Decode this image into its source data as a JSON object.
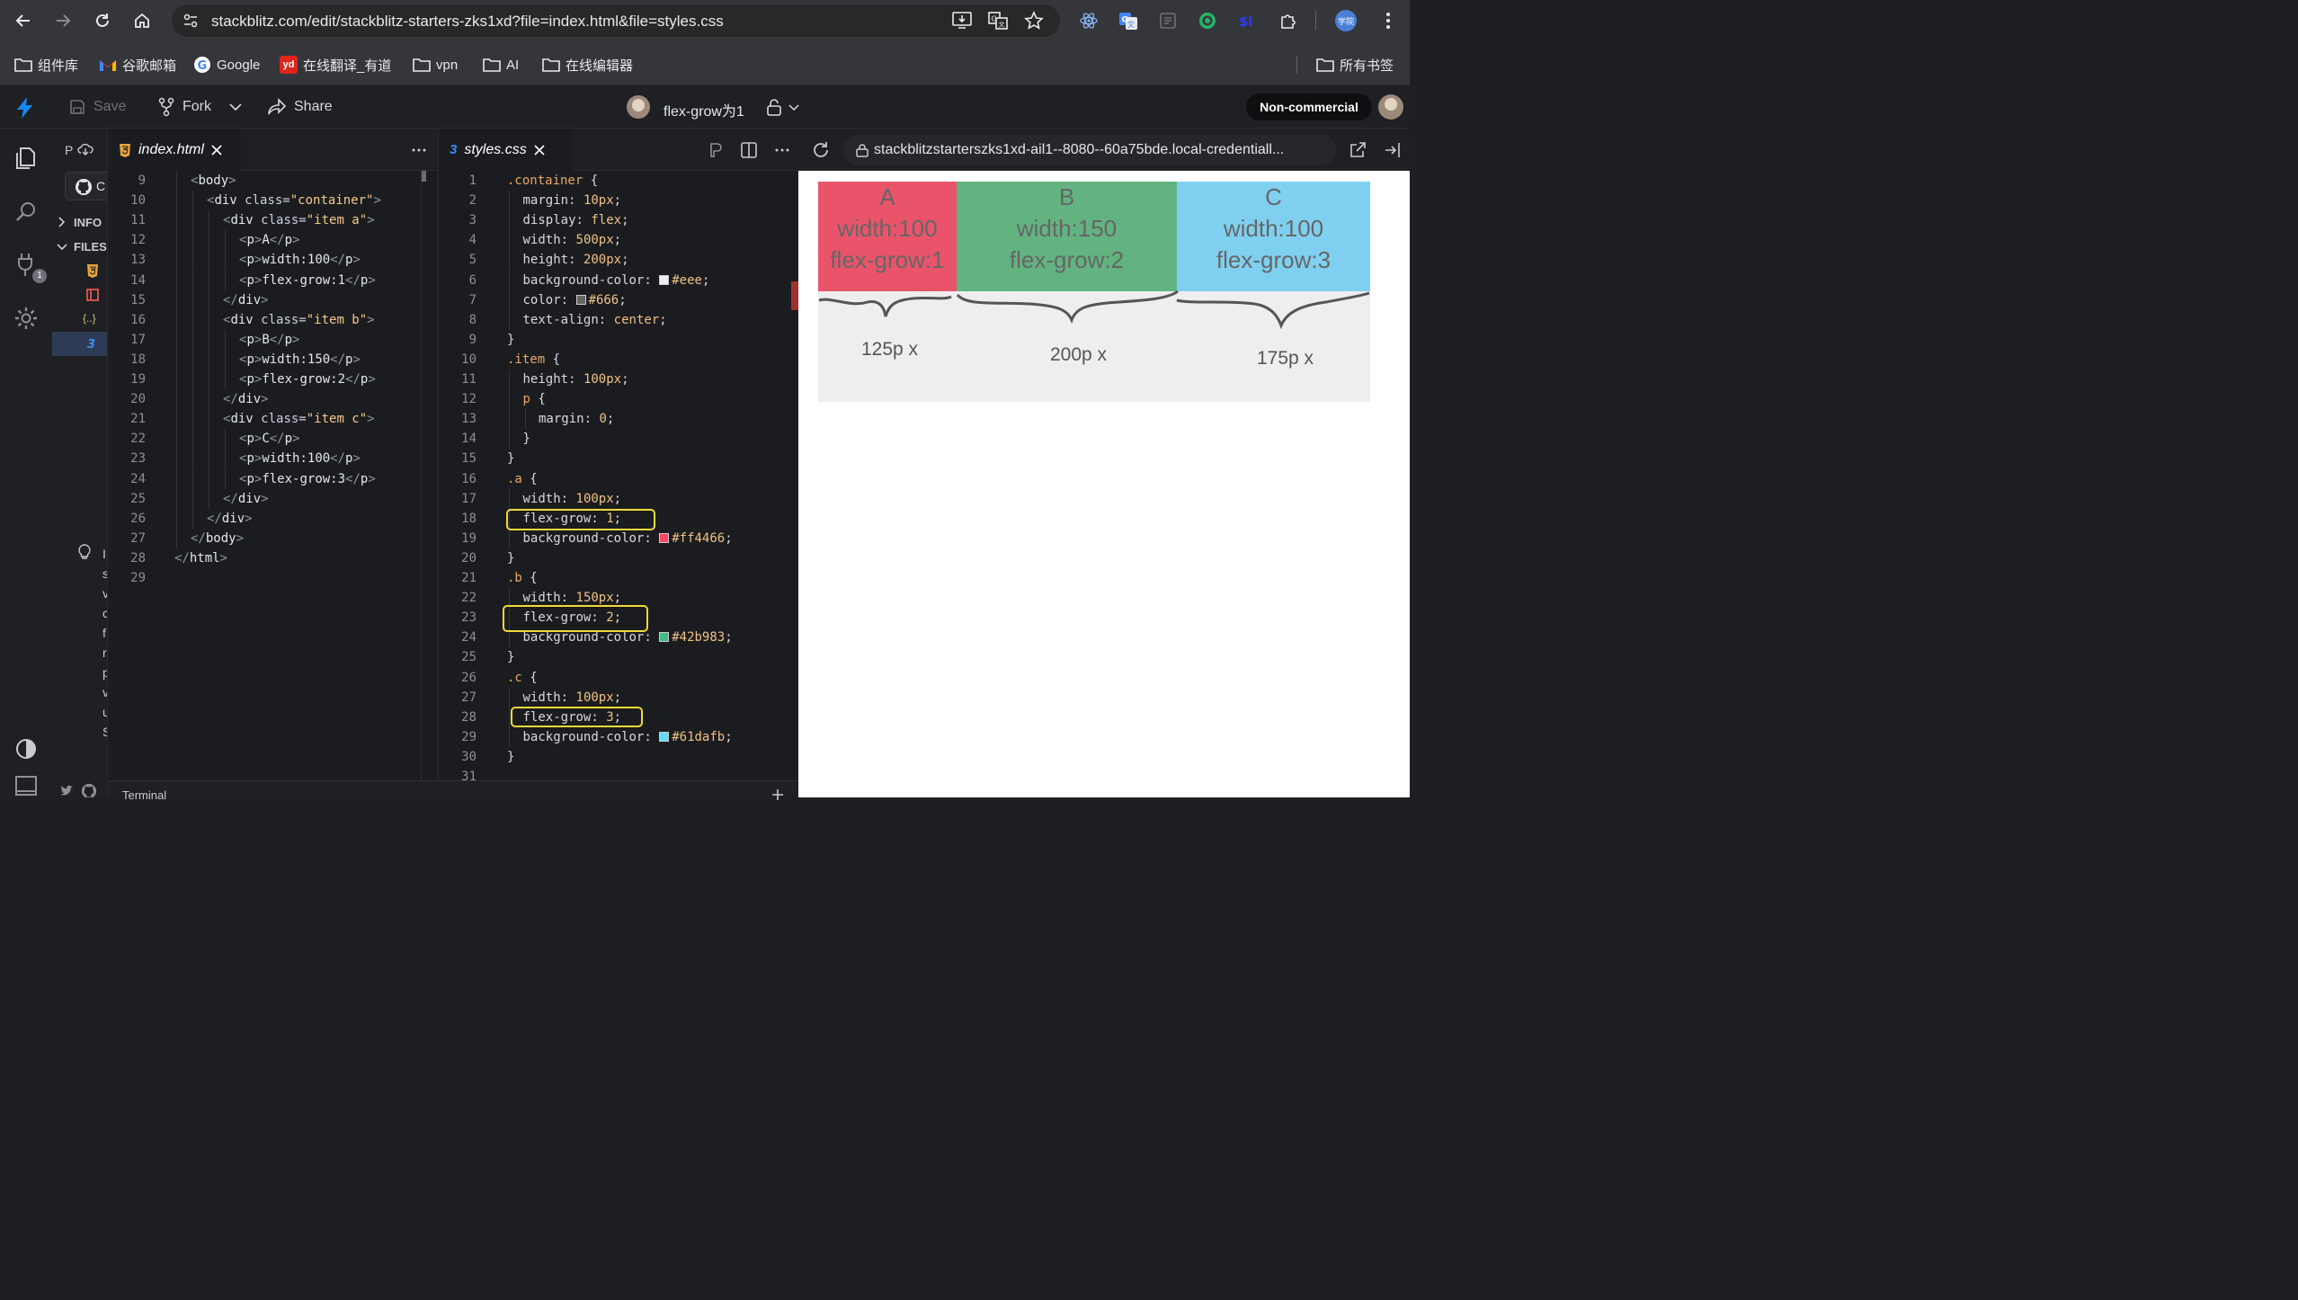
{
  "browser": {
    "url": "stackblitz.com/edit/stackblitz-starters-zks1xd?file=index.html&file=styles.css",
    "profile_label": "学院"
  },
  "bookmarks": [
    {
      "label": "组件库",
      "icon": "folder-icon"
    },
    {
      "label": "谷歌邮箱",
      "icon": "gmail-icon"
    },
    {
      "label": "Google",
      "icon": "google-icon"
    },
    {
      "label": "在线翻译_有道",
      "icon": "youdao-icon",
      "badge": "yd"
    },
    {
      "label": "vpn",
      "icon": "folder-icon"
    },
    {
      "label": "AI",
      "icon": "folder-icon"
    },
    {
      "label": "在线编辑器",
      "icon": "folder-icon"
    },
    {
      "label": "所有书签",
      "icon": "folder-icon"
    }
  ],
  "header": {
    "save": "Save",
    "fork": "Fork",
    "share": "Share",
    "project": "flex-grow为1",
    "license": "Non-commercial"
  },
  "activity": {
    "badge": "1"
  },
  "tree": {
    "project_initial": "P",
    "sections": [
      "INFO",
      "FILES"
    ],
    "github_initial": "C",
    "tip_letters": [
      "I",
      "s",
      "v",
      "c",
      "f",
      "r",
      "p",
      "v",
      "u",
      "S"
    ]
  },
  "tabs": {
    "left": "index.html",
    "right": "styles.css"
  },
  "html_lines": [
    {
      "n": "9",
      "indent": 1,
      "parts": [
        [
          "tag",
          "<"
        ],
        [
          "tn",
          "body"
        ],
        [
          "tag",
          ">"
        ]
      ]
    },
    {
      "n": "10",
      "indent": 2,
      "parts": [
        [
          "tag",
          "<"
        ],
        [
          "tn",
          "div "
        ],
        [
          "an",
          "class="
        ],
        [
          "av",
          "\"container\""
        ],
        [
          "tag",
          ">"
        ]
      ]
    },
    {
      "n": "11",
      "indent": 3,
      "parts": [
        [
          "tag",
          "<"
        ],
        [
          "tn",
          "div "
        ],
        [
          "an",
          "class="
        ],
        [
          "av",
          "\"item a\""
        ],
        [
          "tag",
          ">"
        ]
      ]
    },
    {
      "n": "12",
      "indent": 4,
      "parts": [
        [
          "tag",
          "<"
        ],
        [
          "tn",
          "p"
        ],
        [
          "tag",
          ">"
        ],
        [
          "tn",
          "A"
        ],
        [
          "tag",
          "</"
        ],
        [
          "tn",
          "p"
        ],
        [
          "tag",
          ">"
        ]
      ]
    },
    {
      "n": "13",
      "indent": 4,
      "parts": [
        [
          "tag",
          "<"
        ],
        [
          "tn",
          "p"
        ],
        [
          "tag",
          ">"
        ],
        [
          "tn",
          "width:100"
        ],
        [
          "tag",
          "</"
        ],
        [
          "tn",
          "p"
        ],
        [
          "tag",
          ">"
        ]
      ]
    },
    {
      "n": "14",
      "indent": 4,
      "parts": [
        [
          "tag",
          "<"
        ],
        [
          "tn",
          "p"
        ],
        [
          "tag",
          ">"
        ],
        [
          "tn",
          "flex-grow:1"
        ],
        [
          "tag",
          "</"
        ],
        [
          "tn",
          "p"
        ],
        [
          "tag",
          ">"
        ]
      ]
    },
    {
      "n": "15",
      "indent": 3,
      "parts": [
        [
          "tag",
          "</"
        ],
        [
          "tn",
          "div"
        ],
        [
          "tag",
          ">"
        ]
      ]
    },
    {
      "n": "16",
      "indent": 3,
      "parts": [
        [
          "tag",
          "<"
        ],
        [
          "tn",
          "div "
        ],
        [
          "an",
          "class="
        ],
        [
          "av",
          "\"item b\""
        ],
        [
          "tag",
          ">"
        ]
      ]
    },
    {
      "n": "17",
      "indent": 4,
      "parts": [
        [
          "tag",
          "<"
        ],
        [
          "tn",
          "p"
        ],
        [
          "tag",
          ">"
        ],
        [
          "tn",
          "B"
        ],
        [
          "tag",
          "</"
        ],
        [
          "tn",
          "p"
        ],
        [
          "tag",
          ">"
        ]
      ]
    },
    {
      "n": "18",
      "indent": 4,
      "parts": [
        [
          "tag",
          "<"
        ],
        [
          "tn",
          "p"
        ],
        [
          "tag",
          ">"
        ],
        [
          "tn",
          "width:150"
        ],
        [
          "tag",
          "</"
        ],
        [
          "tn",
          "p"
        ],
        [
          "tag",
          ">"
        ]
      ]
    },
    {
      "n": "19",
      "indent": 4,
      "parts": [
        [
          "tag",
          "<"
        ],
        [
          "tn",
          "p"
        ],
        [
          "tag",
          ">"
        ],
        [
          "tn",
          "flex-grow:2"
        ],
        [
          "tag",
          "</"
        ],
        [
          "tn",
          "p"
        ],
        [
          "tag",
          ">"
        ]
      ]
    },
    {
      "n": "20",
      "indent": 3,
      "parts": [
        [
          "tag",
          "</"
        ],
        [
          "tn",
          "div"
        ],
        [
          "tag",
          ">"
        ]
      ]
    },
    {
      "n": "21",
      "indent": 3,
      "parts": [
        [
          "tag",
          "<"
        ],
        [
          "tn",
          "div "
        ],
        [
          "an",
          "class="
        ],
        [
          "av",
          "\"item c\""
        ],
        [
          "tag",
          ">"
        ]
      ]
    },
    {
      "n": "22",
      "indent": 4,
      "parts": [
        [
          "tag",
          "<"
        ],
        [
          "tn",
          "p"
        ],
        [
          "tag",
          ">"
        ],
        [
          "tn",
          "C"
        ],
        [
          "tag",
          "</"
        ],
        [
          "tn",
          "p"
        ],
        [
          "tag",
          ">"
        ]
      ]
    },
    {
      "n": "23",
      "indent": 4,
      "parts": [
        [
          "tag",
          "<"
        ],
        [
          "tn",
          "p"
        ],
        [
          "tag",
          ">"
        ],
        [
          "tn",
          "width:100"
        ],
        [
          "tag",
          "</"
        ],
        [
          "tn",
          "p"
        ],
        [
          "tag",
          ">"
        ]
      ]
    },
    {
      "n": "24",
      "indent": 4,
      "parts": [
        [
          "tag",
          "<"
        ],
        [
          "tn",
          "p"
        ],
        [
          "tag",
          ">"
        ],
        [
          "tn",
          "flex-grow:3"
        ],
        [
          "tag",
          "</"
        ],
        [
          "tn",
          "p"
        ],
        [
          "tag",
          ">"
        ]
      ]
    },
    {
      "n": "25",
      "indent": 3,
      "parts": [
        [
          "tag",
          "</"
        ],
        [
          "tn",
          "div"
        ],
        [
          "tag",
          ">"
        ]
      ]
    },
    {
      "n": "26",
      "indent": 2,
      "parts": [
        [
          "tag",
          "</"
        ],
        [
          "tn",
          "div"
        ],
        [
          "tag",
          ">"
        ]
      ]
    },
    {
      "n": "27",
      "indent": 1,
      "parts": [
        [
          "tag",
          "</"
        ],
        [
          "tn",
          "body"
        ],
        [
          "tag",
          ">"
        ]
      ]
    },
    {
      "n": "28",
      "indent": 0,
      "parts": [
        [
          "tag",
          "</"
        ],
        [
          "tn",
          "html"
        ],
        [
          "tag",
          ">"
        ]
      ]
    },
    {
      "n": "29",
      "indent": 0,
      "parts": []
    }
  ],
  "css_lines": [
    {
      "n": "1",
      "indent": 0,
      "parts": [
        [
          "sel",
          ".container"
        ],
        [
          "pun",
          " {"
        ]
      ]
    },
    {
      "n": "2",
      "indent": 1,
      "parts": [
        [
          "pr",
          "margin"
        ],
        [
          "pun",
          ": "
        ],
        [
          "val",
          "10px"
        ],
        [
          "pun",
          ";"
        ]
      ]
    },
    {
      "n": "3",
      "indent": 1,
      "parts": [
        [
          "pr",
          "display"
        ],
        [
          "pun",
          ": "
        ],
        [
          "val",
          "flex"
        ],
        [
          "pun",
          ";"
        ]
      ]
    },
    {
      "n": "4",
      "indent": 1,
      "parts": [
        [
          "pr",
          "width"
        ],
        [
          "pun",
          ": "
        ],
        [
          "val",
          "500px"
        ],
        [
          "pun",
          ";"
        ]
      ]
    },
    {
      "n": "5",
      "indent": 1,
      "parts": [
        [
          "pr",
          "height"
        ],
        [
          "pun",
          ": "
        ],
        [
          "val",
          "200px"
        ],
        [
          "pun",
          ";"
        ]
      ]
    },
    {
      "n": "6",
      "indent": 1,
      "parts": [
        [
          "pr",
          "background-color"
        ],
        [
          "pun",
          ": "
        ],
        [
          "swatch",
          "#eeeeee"
        ],
        [
          "val",
          "#eee"
        ],
        [
          "pun",
          ";"
        ]
      ]
    },
    {
      "n": "7",
      "indent": 1,
      "parts": [
        [
          "pr",
          "color"
        ],
        [
          "pun",
          ": "
        ],
        [
          "swatch",
          "#666666"
        ],
        [
          "val",
          "#666"
        ],
        [
          "pun",
          ";"
        ]
      ]
    },
    {
      "n": "8",
      "indent": 1,
      "parts": [
        [
          "pr",
          "text-align"
        ],
        [
          "pun",
          ": "
        ],
        [
          "val",
          "center"
        ],
        [
          "pun",
          ";"
        ]
      ]
    },
    {
      "n": "9",
      "indent": 0,
      "parts": [
        [
          "pun",
          "}"
        ]
      ]
    },
    {
      "n": "10",
      "indent": 0,
      "parts": [
        [
          "sel",
          ".item"
        ],
        [
          "pun",
          " {"
        ]
      ]
    },
    {
      "n": "11",
      "indent": 1,
      "parts": [
        [
          "pr",
          "height"
        ],
        [
          "pun",
          ": "
        ],
        [
          "val",
          "100px"
        ],
        [
          "pun",
          ";"
        ]
      ]
    },
    {
      "n": "12",
      "indent": 1,
      "parts": [
        [
          "sel",
          "p"
        ],
        [
          "pun",
          " {"
        ]
      ]
    },
    {
      "n": "13",
      "indent": 2,
      "parts": [
        [
          "pr",
          "margin"
        ],
        [
          "pun",
          ": "
        ],
        [
          "val",
          "0"
        ],
        [
          "pun",
          ";"
        ]
      ]
    },
    {
      "n": "14",
      "indent": 1,
      "parts": [
        [
          "pun",
          "}"
        ]
      ]
    },
    {
      "n": "15",
      "indent": 0,
      "parts": [
        [
          "pun",
          "}"
        ]
      ]
    },
    {
      "n": "16",
      "indent": 0,
      "parts": [
        [
          "sel",
          ".a"
        ],
        [
          "pun",
          " {"
        ]
      ]
    },
    {
      "n": "17",
      "indent": 1,
      "parts": [
        [
          "pr",
          "width"
        ],
        [
          "pun",
          ": "
        ],
        [
          "val",
          "100px"
        ],
        [
          "pun",
          ";"
        ]
      ]
    },
    {
      "n": "18",
      "indent": 1,
      "parts": [
        [
          "pr",
          "flex-grow"
        ],
        [
          "pun",
          ": "
        ],
        [
          "val",
          "1"
        ],
        [
          "pun",
          ";"
        ]
      ]
    },
    {
      "n": "19",
      "indent": 1,
      "parts": [
        [
          "pr",
          "background-color"
        ],
        [
          "pun",
          ": "
        ],
        [
          "swatch",
          "#ff4466"
        ],
        [
          "val",
          "#ff4466"
        ],
        [
          "pun",
          ";"
        ]
      ]
    },
    {
      "n": "20",
      "indent": 0,
      "parts": [
        [
          "pun",
          "}"
        ]
      ]
    },
    {
      "n": "21",
      "indent": 0,
      "parts": [
        [
          "sel",
          ".b"
        ],
        [
          "pun",
          " {"
        ]
      ]
    },
    {
      "n": "22",
      "indent": 1,
      "parts": [
        [
          "pr",
          "width"
        ],
        [
          "pun",
          ": "
        ],
        [
          "val",
          "150px"
        ],
        [
          "pun",
          ";"
        ]
      ]
    },
    {
      "n": "23",
      "indent": 1,
      "parts": [
        [
          "pr",
          "flex-grow"
        ],
        [
          "pun",
          ": "
        ],
        [
          "val",
          "2"
        ],
        [
          "pun",
          ";"
        ]
      ]
    },
    {
      "n": "24",
      "indent": 1,
      "parts": [
        [
          "pr",
          "background-color"
        ],
        [
          "pun",
          ": "
        ],
        [
          "swatch",
          "#42b983"
        ],
        [
          "val",
          "#42b983"
        ],
        [
          "pun",
          ";"
        ]
      ]
    },
    {
      "n": "25",
      "indent": 0,
      "parts": [
        [
          "pun",
          "}"
        ]
      ]
    },
    {
      "n": "26",
      "indent": 0,
      "parts": [
        [
          "sel",
          ".c"
        ],
        [
          "pun",
          " {"
        ]
      ]
    },
    {
      "n": "27",
      "indent": 1,
      "parts": [
        [
          "pr",
          "width"
        ],
        [
          "pun",
          ": "
        ],
        [
          "val",
          "100px"
        ],
        [
          "pun",
          ";"
        ]
      ]
    },
    {
      "n": "28",
      "indent": 1,
      "parts": [
        [
          "pr",
          "flex-grow"
        ],
        [
          "pun",
          ": "
        ],
        [
          "val",
          "3"
        ],
        [
          "pun",
          ";"
        ]
      ]
    },
    {
      "n": "29",
      "indent": 1,
      "parts": [
        [
          "pr",
          "background-color"
        ],
        [
          "pun",
          ": "
        ],
        [
          "swatch",
          "#61dafb"
        ],
        [
          "val",
          "#61dafb"
        ],
        [
          "pun",
          ";"
        ]
      ]
    },
    {
      "n": "30",
      "indent": 0,
      "parts": [
        [
          "pun",
          "}"
        ]
      ]
    },
    {
      "n": "31",
      "indent": 0,
      "parts": []
    }
  ],
  "preview": {
    "url": "stackblitzstarterszks1xd-ail1--8080--60a75bde.local-credentiall...",
    "items": [
      {
        "letter": "A",
        "width": "width:100",
        "grow": "flex-grow:1",
        "color": "#e9546b"
      },
      {
        "letter": "B",
        "width": "width:150",
        "grow": "flex-grow:2",
        "color": "#62b380"
      },
      {
        "letter": "C",
        "width": "width:100",
        "grow": "flex-grow:3",
        "color": "#7fd0f0"
      }
    ],
    "annotations": [
      "125p x",
      "200p x",
      "175p x"
    ]
  },
  "terminal": {
    "label": "Terminal"
  },
  "colors": {
    "highlight": "#f2d93a",
    "accent": "#1389fd"
  }
}
